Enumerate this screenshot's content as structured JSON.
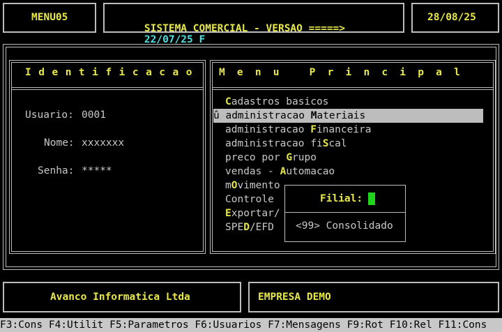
{
  "header": {
    "menu_id": "MENU05",
    "system_title": "SISTEMA COMERCIAL - VERSAO =====>",
    "version_date": "22/07/25 F",
    "current_date": "28/08/25"
  },
  "identification": {
    "title": "Identificacao",
    "user_label": "Usuario:",
    "user_value": "0001",
    "name_label": "Nome:",
    "name_value": "xxxxxxx",
    "password_label": "Senha:",
    "password_value": "*****"
  },
  "main_menu": {
    "title": "Menu Principal",
    "selected_marker": "û",
    "items": [
      {
        "pre": "",
        "hot": "C",
        "post": "adastros basicos"
      },
      {
        "pre": "administracao ",
        "hot": "M",
        "post": "ateriais"
      },
      {
        "pre": "administracao ",
        "hot": "F",
        "post": "inanceira"
      },
      {
        "pre": "administracao fi",
        "hot": "S",
        "post": "cal"
      },
      {
        "pre": "preco por ",
        "hot": "G",
        "post": "rupo"
      },
      {
        "pre": "vendas - ",
        "hot": "A",
        "post": "utomacao"
      },
      {
        "pre": "m",
        "hot": "O",
        "post": "vimento"
      },
      {
        "pre": "Controle",
        "hot": "",
        "post": ""
      },
      {
        "pre": "",
        "hot": "E",
        "post": "xportar/"
      },
      {
        "pre": "SPE",
        "hot": "D",
        "post": "/EFD"
      }
    ]
  },
  "filial_popup": {
    "label": "Filial:",
    "option": "<99> Consolidado"
  },
  "footer": {
    "company_vendor": "Avanco Informatica Ltda",
    "company_name": "EMPRESA DEMO"
  },
  "function_keys": "F3:Cons F4:Utilit F5:Parametros F6:Usuarios F7:Mensagens F9:Rot F10:Rel F11:Cons",
  "colors": {
    "background": "#000000",
    "highlight_text": "#e8e84a",
    "version_text": "#4ee0e0",
    "selection_bar": "#bdbdbd",
    "cursor": "#1fd31f"
  }
}
